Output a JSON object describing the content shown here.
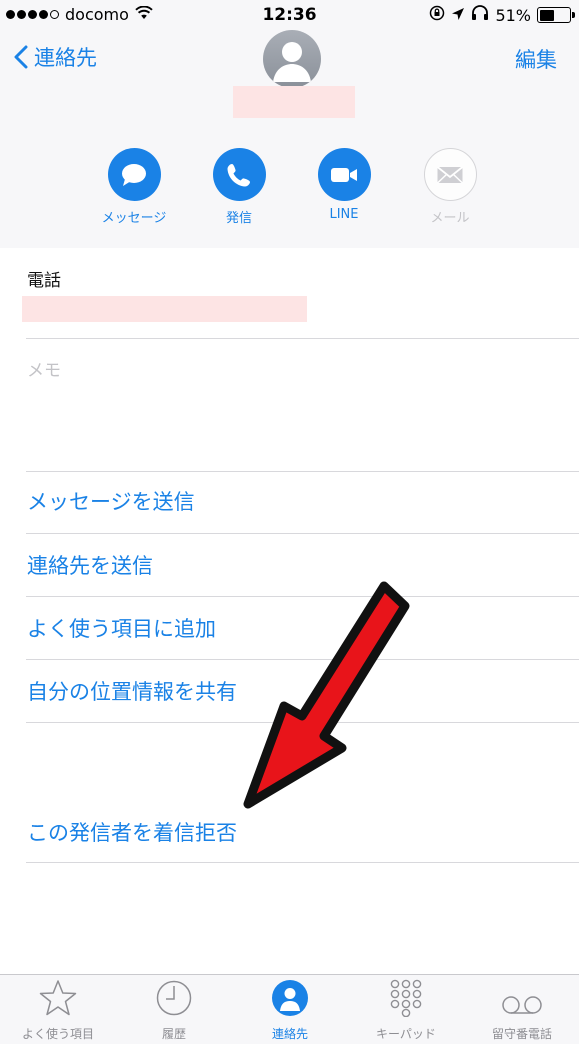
{
  "status_bar": {
    "carrier": "docomo",
    "time": "12:36",
    "battery": "51%"
  },
  "nav": {
    "back_label": "連絡先",
    "edit_label": "編集"
  },
  "actions": [
    {
      "label": "メッセージ",
      "icon": "message-bubble-icon",
      "enabled": true
    },
    {
      "label": "発信",
      "icon": "phone-icon",
      "enabled": true
    },
    {
      "label": "LINE",
      "icon": "video-camera-icon",
      "enabled": true
    },
    {
      "label": "メール",
      "icon": "mail-icon",
      "enabled": false
    }
  ],
  "content": {
    "phone_label": "電話",
    "memo_label": "メモ",
    "links": [
      "メッセージを送信",
      "連絡先を送信",
      "よく使う項目に追加",
      "自分の位置情報を共有",
      "この発信者を着信拒否"
    ]
  },
  "tabbar": {
    "tabs": [
      {
        "label": "よく使う項目",
        "icon": "star-icon",
        "active": false
      },
      {
        "label": "履歴",
        "icon": "clock-icon",
        "active": false
      },
      {
        "label": "連絡先",
        "icon": "contacts-person-icon",
        "active": true
      },
      {
        "label": "キーパッド",
        "icon": "keypad-icon",
        "active": false
      },
      {
        "label": "留守番電話",
        "icon": "voicemail-icon",
        "active": false
      }
    ]
  },
  "colors": {
    "accent": "#1a82e6",
    "header_bg": "#f7f7f9",
    "redaction": "#fde4e4",
    "arrow_red": "#e8141a"
  }
}
